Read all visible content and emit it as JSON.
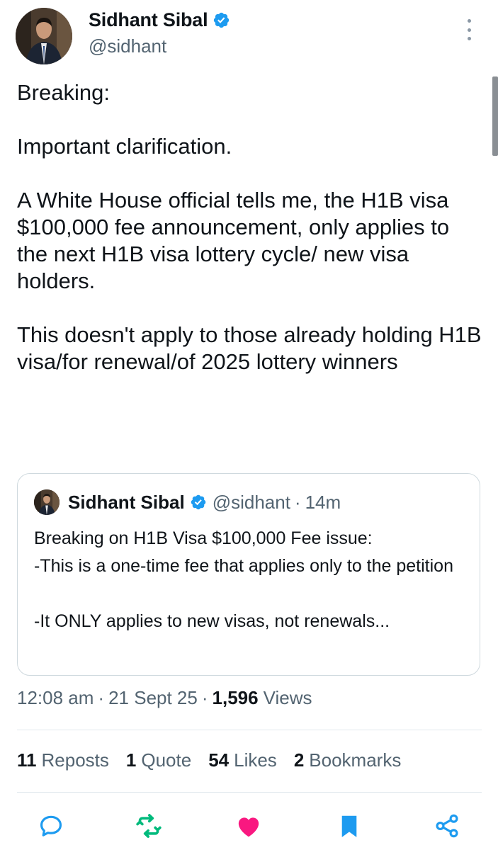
{
  "author": {
    "display_name": "Sidhant Sibal",
    "handle": "@sidhant",
    "verified": true
  },
  "tweet": {
    "text": "Breaking:\n\nImportant clarification.\n\nA White House official tells me, the H1B visa $100,000 fee announcement, only applies to the next H1B visa lottery cycle/ new visa holders.\n\nThis doesn't apply to those already holding H1B visa/for renewal/of 2025 lottery winners"
  },
  "quote": {
    "display_name": "Sidhant Sibal",
    "handle": "@sidhant",
    "separator": "·",
    "time": "14m",
    "text": "Breaking on H1B Visa $100,000 Fee issue:\n-This is a one-time fee that applies only to the petition\n\n-It ONLY applies to new visas, not renewals..."
  },
  "meta": {
    "time": "12:08 am",
    "separator": "·",
    "date": "21 Sept 25",
    "views_count": "1,596",
    "views_label": "Views"
  },
  "stats": {
    "reposts_count": "11",
    "reposts_label": "Reposts",
    "quotes_count": "1",
    "quotes_label": "Quote",
    "likes_count": "54",
    "likes_label": "Likes",
    "bookmarks_count": "2",
    "bookmarks_label": "Bookmarks"
  },
  "actions": [
    "reply-icon",
    "repost-icon",
    "like-icon",
    "bookmark-icon",
    "share-icon"
  ],
  "colors": {
    "verified": "#1d9bf0",
    "repost": "#00ba7c",
    "like": "#f91880",
    "bookmark": "#1d9bf0",
    "secondary_text": "#536471"
  }
}
